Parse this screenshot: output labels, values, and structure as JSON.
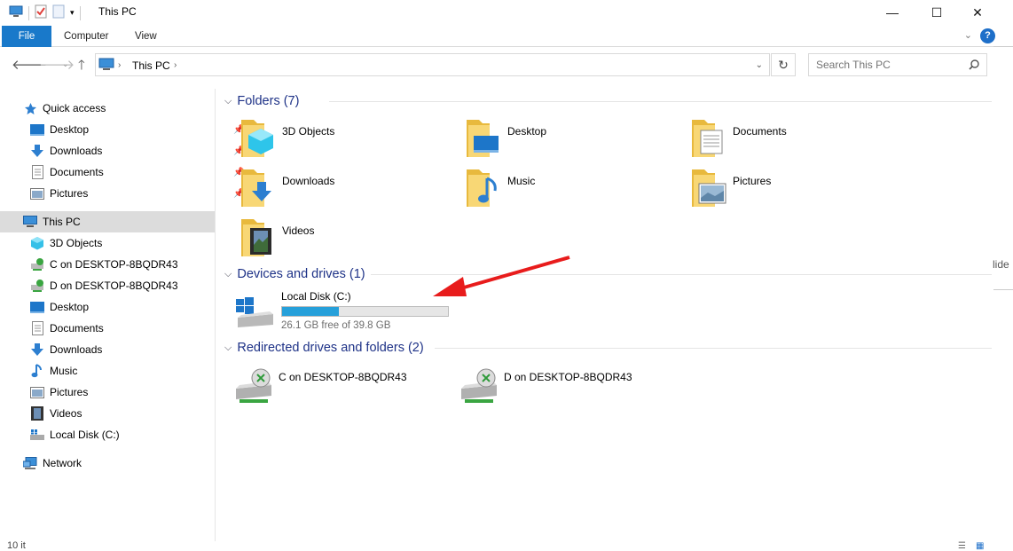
{
  "window": {
    "title": "This PC",
    "minimize_glyph": "—",
    "maximize_glyph": "☐",
    "close_glyph": "✕"
  },
  "ribbon": {
    "tabs": [
      "File",
      "Computer",
      "View"
    ],
    "help_glyph": "?",
    "collapse_glyph": "⌄"
  },
  "address": {
    "path": "This PC",
    "search_placeholder": "Search This PC"
  },
  "nav": {
    "quick_access": "Quick access",
    "pinned": [
      "Desktop",
      "Downloads",
      "Documents",
      "Pictures"
    ],
    "this_pc": "This PC",
    "this_pc_children": [
      "3D Objects",
      "C on DESKTOP-8BQDR43",
      "D on DESKTOP-8BQDR43",
      "Desktop",
      "Documents",
      "Downloads",
      "Music",
      "Pictures",
      "Videos",
      "Local Disk (C:)"
    ],
    "network": "Network"
  },
  "content": {
    "folders_header": "Folders (7)",
    "folders": [
      "3D Objects",
      "Desktop",
      "Documents",
      "Downloads",
      "Music",
      "Pictures",
      "Videos"
    ],
    "devices_header": "Devices and drives (1)",
    "drive": {
      "name": "Local Disk (C:)",
      "free_text": "26.1 GB free of 39.8 GB",
      "used_fraction": 0.344
    },
    "redirected_header": "Redirected drives and folders (2)",
    "redirected": [
      "C on DESKTOP-8BQDR43",
      "D on DESKTOP-8BQDR43"
    ]
  },
  "status": {
    "items_text": "10 it"
  },
  "cutoff_text": "lide",
  "colors": {
    "accent": "#1979ca",
    "header_blue": "#1e3287",
    "folder_yellow": "#f8d775",
    "progress": "#26a0da",
    "annotation_arrow": "#e81c1c"
  }
}
